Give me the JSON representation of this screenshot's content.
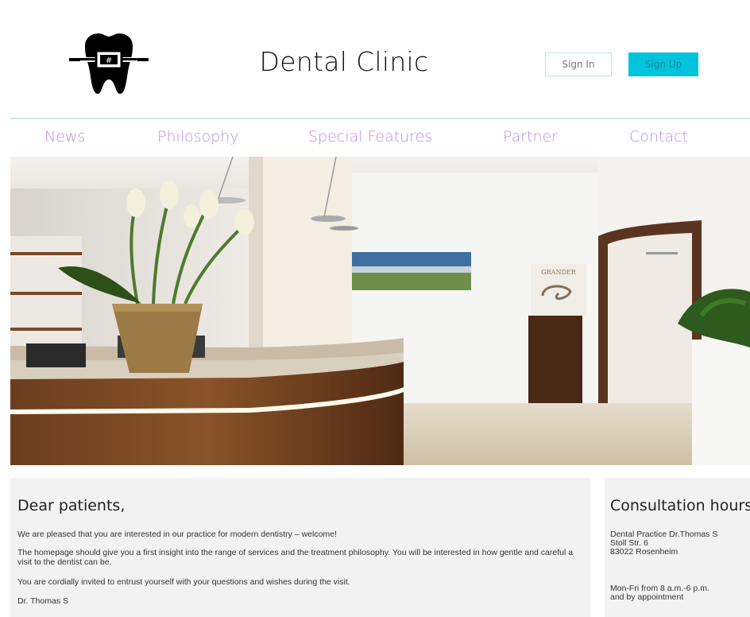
{
  "header": {
    "logo_icon": "tooth-with-braces-icon",
    "title": "Dental Clinic",
    "sign_in_label": "Sign In",
    "sign_up_label": "Sign Up"
  },
  "nav": {
    "items": [
      {
        "label": "News"
      },
      {
        "label": "Philosophy"
      },
      {
        "label": "Special Features"
      },
      {
        "label": "Partner"
      },
      {
        "label": "Contact"
      }
    ]
  },
  "hero": {
    "image_description": "clinic-reception-photo",
    "sign_text": "GRANDER"
  },
  "welcome": {
    "heading": "Dear patients,",
    "paragraph_1": "We are pleased that you are interested in our practice for modern dentistry – welcome!",
    "paragraph_2": "The homepage should give you a first insight into the range of services and the treatment philosophy. You will be interested in how gentle and careful a visit to the dentist can be.",
    "paragraph_3": "You are cordially invited to entrust yourself with your questions and wishes during the visit.",
    "signature": "Dr. Thomas S"
  },
  "consultation": {
    "heading": "Consultation hours",
    "practice": "Dental Practice Dr.Thomas S",
    "street": "Stoll Str. 6",
    "city": "83022 Rosenheim",
    "hours": "Mon-Fri from 8 a.m.-6 p.m.",
    "appointment": "and by appointment"
  },
  "colors": {
    "accent": "#00c4dd",
    "nav_text": "#b98ee6",
    "panel_bg": "#f2f2f2"
  }
}
